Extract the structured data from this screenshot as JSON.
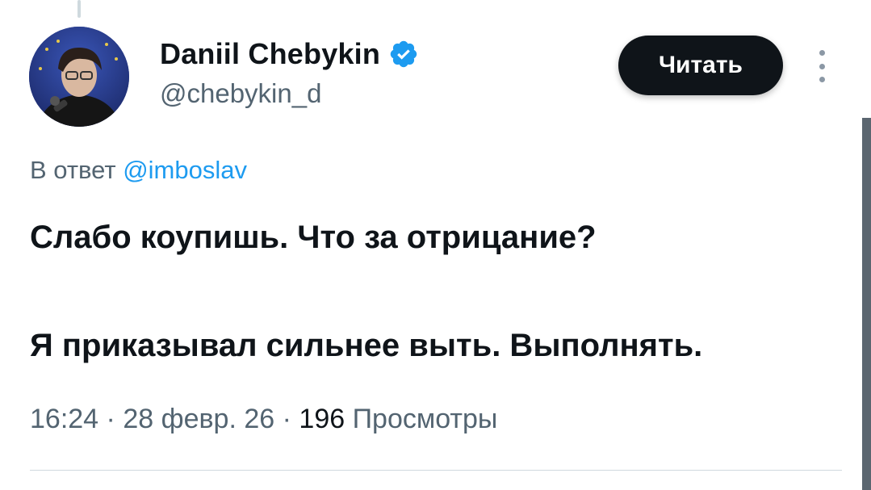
{
  "tweet": {
    "author": {
      "display_name": "Daniil Chebykin",
      "handle": "@chebykin_d",
      "verified": true,
      "avatar_icon": "user-avatar-photo"
    },
    "follow_button_label": "Читать",
    "more_icon": "more-vertical-icon",
    "reply_prefix": "В ответ",
    "reply_mention": "@imboslav",
    "text_line_1": "Слабо коупишь. Что за отрицание?",
    "text_line_2": "Я приказывал сильнее выть. Выполнять.",
    "time": "16:24",
    "date": "28 февр. 26",
    "views_count": "196",
    "views_label": "Просмотры",
    "separator": "·"
  },
  "colors": {
    "text_primary": "#0f1419",
    "text_secondary": "#536471",
    "accent": "#1d9bf0",
    "button_bg": "#0f1419",
    "button_text": "#ffffff"
  }
}
